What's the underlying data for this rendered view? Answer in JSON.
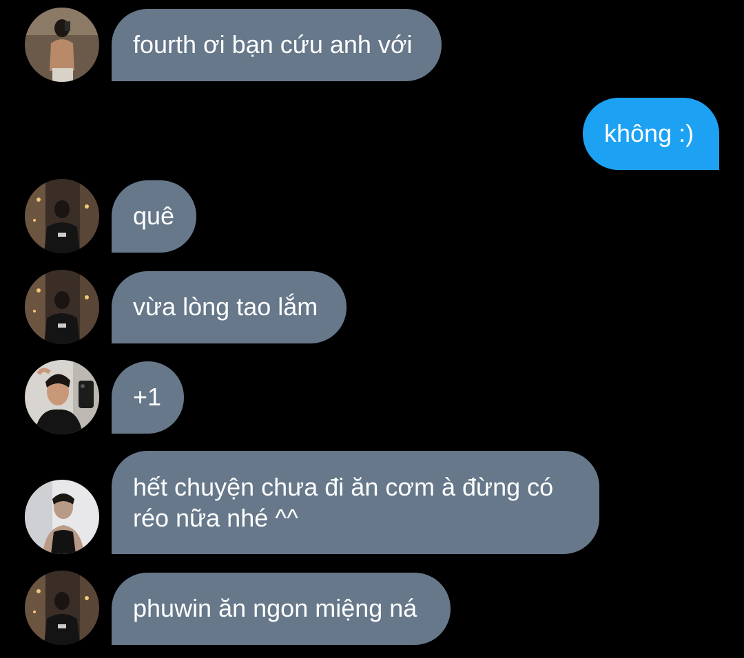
{
  "colors": {
    "background": "#000000",
    "incoming_bubble": "#66788a",
    "outgoing_bubble": "#1da1f2",
    "text": "#ffffff"
  },
  "messages": [
    {
      "sender": "incoming",
      "avatar": "avatar-shirtless-mirror-selfie",
      "text": "fourth ơi bạn cứu anh với"
    },
    {
      "sender": "outgoing",
      "text": "không :)"
    },
    {
      "sender": "incoming",
      "avatar": "avatar-street-night",
      "text": "quê"
    },
    {
      "sender": "incoming",
      "avatar": "avatar-street-night",
      "text": "vừa lòng tao lắm"
    },
    {
      "sender": "incoming",
      "avatar": "avatar-phone-mirror-selfie",
      "text": "+1"
    },
    {
      "sender": "incoming",
      "avatar": "avatar-tank-top-portrait",
      "text": "hết chuyện chưa đi ăn cơm à đừng có réo nữa nhé ^^"
    },
    {
      "sender": "incoming",
      "avatar": "avatar-street-night",
      "text": "phuwin ăn ngon miệng ná"
    }
  ]
}
